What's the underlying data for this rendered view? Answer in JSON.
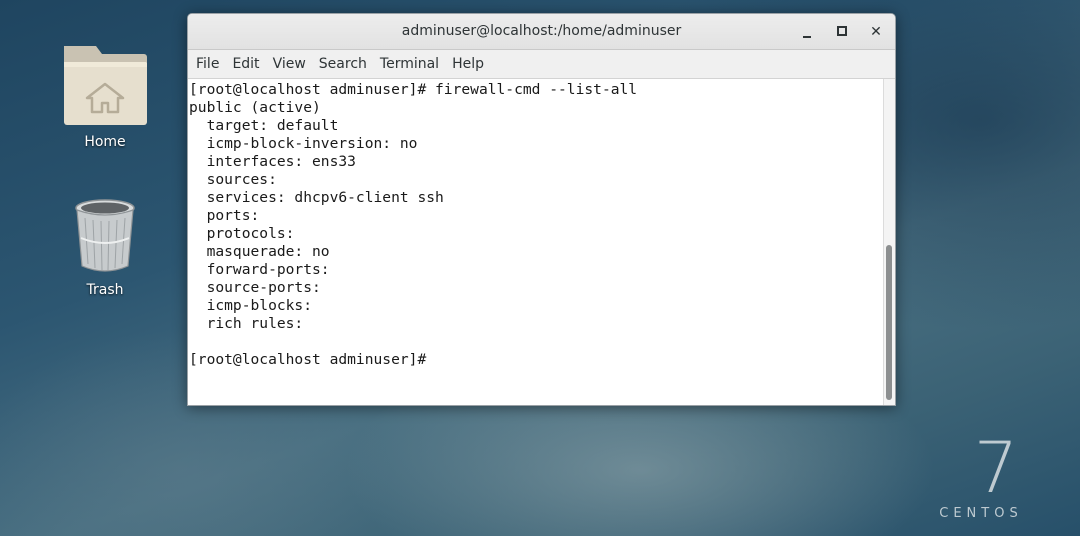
{
  "desktop": {
    "icons": [
      {
        "label": "Home",
        "icon": "home-folder-icon"
      },
      {
        "label": "Trash",
        "icon": "trash-icon"
      }
    ],
    "branding": {
      "number": "7",
      "word": "CENTOS"
    }
  },
  "window": {
    "title": "adminuser@localhost:/home/adminuser",
    "controls": [
      "minimize",
      "maximize",
      "close"
    ],
    "close_glyph": "✕"
  },
  "menu": [
    "File",
    "Edit",
    "View",
    "Search",
    "Terminal",
    "Help"
  ],
  "terminal": {
    "lines": [
      "[root@localhost adminuser]# firewall-cmd --list-all",
      "public (active)",
      "  target: default",
      "  icmp-block-inversion: no",
      "  interfaces: ens33",
      "  sources: ",
      "  services: dhcpv6-client ssh",
      "  ports: ",
      "  protocols: ",
      "  masquerade: no",
      "  forward-ports: ",
      "  source-ports: ",
      "  icmp-blocks: ",
      "  rich rules: ",
      "",
      "[root@localhost adminuser]# "
    ]
  },
  "colors": {
    "terminal_bg": "#ffffff",
    "terminal_fg": "#1a1a1a",
    "titlebar_bg": "#e8e8e8"
  }
}
